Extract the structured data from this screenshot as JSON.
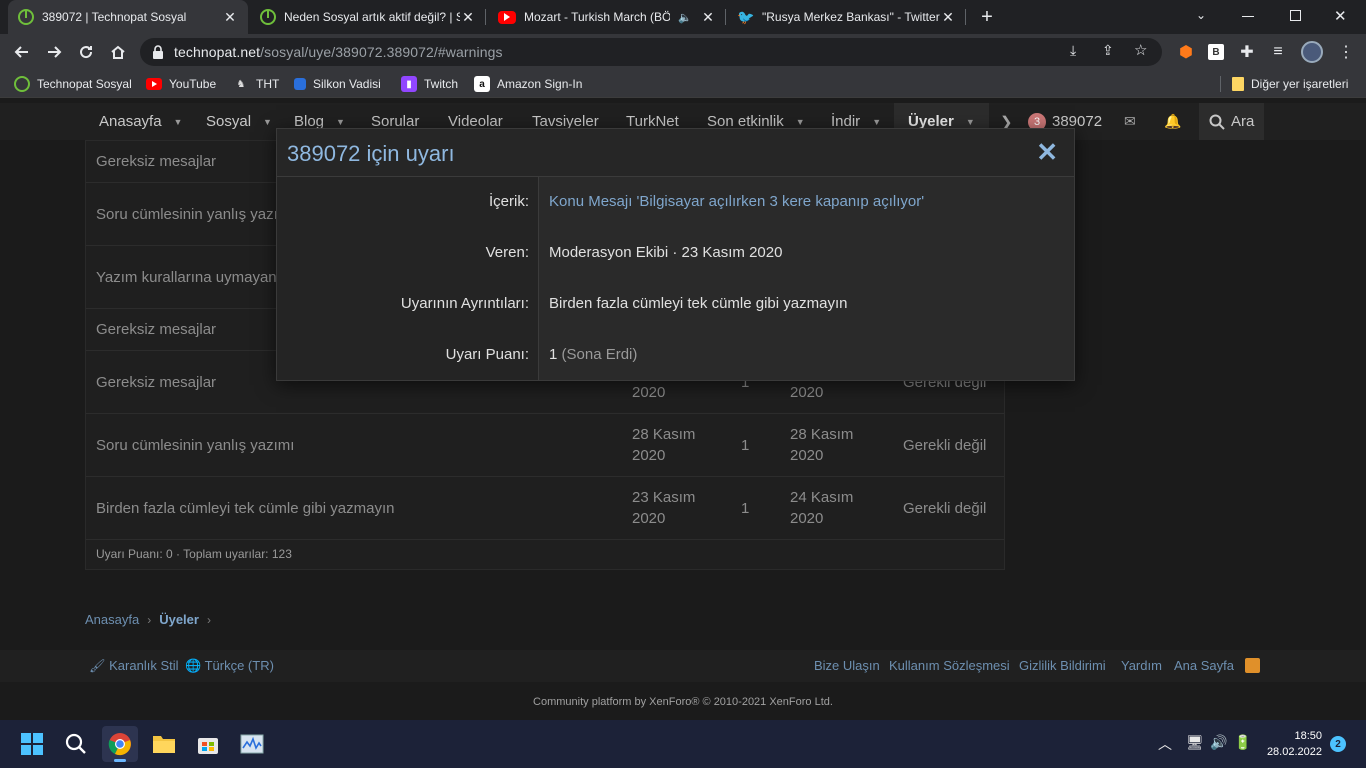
{
  "browser": {
    "tabs": [
      {
        "title": "389072 | Technopat Sosyal",
        "favicon": "power-icon",
        "active": true
      },
      {
        "title": "Neden Sosyal artık aktif değil? | S",
        "favicon": "power-icon",
        "active": false
      },
      {
        "title": "Mozart - Turkish March (BÖ",
        "favicon": "youtube-icon",
        "active": false,
        "audio": true
      },
      {
        "title": "\"Rusya Merkez Bankası\" - Twitter",
        "favicon": "twitter-icon",
        "active": false
      }
    ],
    "url": {
      "host": "technopat.net",
      "path": "/sosyal/uye/389072.389072/#warnings"
    },
    "bookmarks": [
      {
        "label": "Technopat Sosyal",
        "icon": "power-icon"
      },
      {
        "label": "YouTube",
        "icon": "youtube-icon"
      },
      {
        "label": "THT",
        "icon": "tht-icon"
      },
      {
        "label": "Silkon Vadisi",
        "icon": "square-icon"
      },
      {
        "label": "Twitch",
        "icon": "twitch-icon"
      },
      {
        "label": "Amazon Sign-In",
        "icon": "amazon-icon"
      }
    ],
    "other_bookmarks": "Diğer yer işaretleri",
    "extension_badge": "B"
  },
  "nav": {
    "items": [
      "Anasayfa",
      "Sosyal",
      "Blog",
      "Sorular",
      "Videolar",
      "Tavsiyeler",
      "TurkNet",
      "Son etkinlik",
      "İndir",
      "Üyeler"
    ],
    "user_count": "3",
    "username": "389072",
    "search_label": "Ara"
  },
  "warnings": {
    "rows": [
      {
        "reason": "Gereksiz mesajlar",
        "date": "",
        "points": "",
        "expires": "",
        "status": ""
      },
      {
        "reason": "Soru cümlesinin yanlış yazım",
        "date": "",
        "points": "",
        "expires": "",
        "status": ""
      },
      {
        "reason": "Yazım kurallarına uymayan",
        "date": "",
        "points": "",
        "expires": "",
        "status": ""
      },
      {
        "reason": "Gereksiz mesajlar",
        "date": "",
        "points": "",
        "expires": "",
        "status": ""
      },
      {
        "reason": "Gereksiz mesajlar",
        "date": "2020",
        "points": "1",
        "expires": "2020",
        "status": "Gerekli değil"
      },
      {
        "reason": "Soru cümlesinin yanlış yazımı",
        "date": "28 Kasım 2020",
        "points": "1",
        "expires": "28 Kasım 2020",
        "status": "Gerekli değil"
      },
      {
        "reason": "Birden fazla cümleyi tek cümle gibi yazmayın",
        "date": "23 Kasım 2020",
        "points": "1",
        "expires": "24 Kasım 2020",
        "status": "Gerekli değil"
      }
    ],
    "summary": "Uyarı Puanı: 0 · Toplam uyarılar: 123"
  },
  "breadcrumb": {
    "home": "Anasayfa",
    "current": "Üyeler"
  },
  "footer": {
    "style_link": "Karanlık Stil",
    "language_link": "Türkçe (TR)",
    "links": [
      "Bize Ulaşın",
      "Kullanım Sözleşmesi",
      "Gizlilik Bildirimi",
      "Yardım",
      "Ana Sayfa"
    ],
    "copyright": "Community platform by XenForo® © 2010-2021 XenForo Ltd."
  },
  "dialog": {
    "title": "389072 için uyarı",
    "rows": [
      {
        "label": "İçerik:",
        "value": "Konu Mesajı 'Bilgisayar açılırken 3 kere kapanıp açılıyor'"
      },
      {
        "label": "Veren:",
        "value": "Moderasyon Ekibi · 23 Kasım 2020"
      },
      {
        "label": "Uyarının Ayrıntıları:",
        "value": "Birden fazla cümleyi tek cümle gibi yazmayın"
      },
      {
        "label": "Uyarı Puanı:",
        "value": "1",
        "note": "(Sona Erdi)"
      }
    ]
  },
  "taskbar": {
    "time": "18:50",
    "date": "28.02.2022",
    "notification_count": "2"
  }
}
